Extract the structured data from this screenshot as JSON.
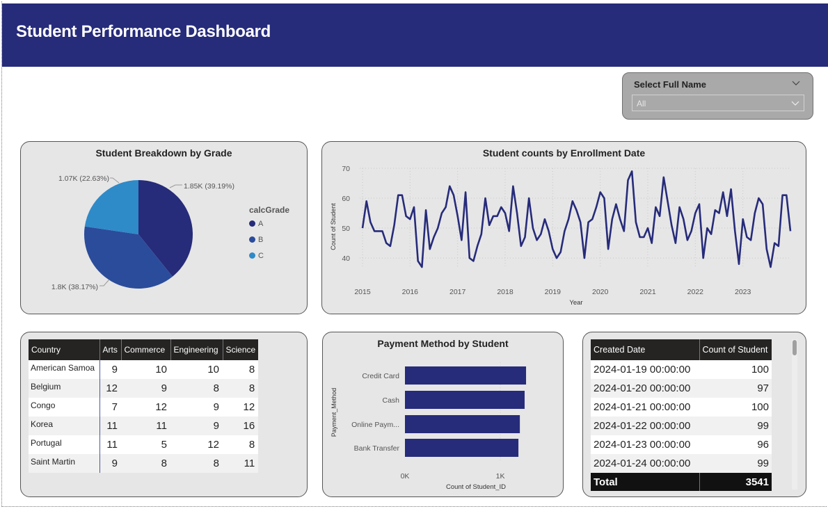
{
  "header": {
    "title": "Student Performance Dashboard"
  },
  "slicer": {
    "title": "Select Full Name",
    "value": "All"
  },
  "pie": {
    "title": "Student Breakdown by Grade",
    "legend_title": "calcGrade",
    "items": [
      {
        "label": "A",
        "data_label": "1.85K (39.19%)",
        "color": "#262b7a"
      },
      {
        "label": "B",
        "data_label": "1.8K (38.17%)",
        "color": "#2b4c9b"
      },
      {
        "label": "C",
        "data_label": "1.07K (22.63%)",
        "color": "#2f8ac8"
      }
    ]
  },
  "line": {
    "title": "Student counts by Enrollment Date"
  },
  "country_table": {
    "headers": [
      "Country",
      "Arts",
      "Commerce",
      "Engineering",
      "Science"
    ],
    "rows": [
      [
        "American Samoa",
        "9",
        "10",
        "10",
        "8"
      ],
      [
        "Belgium",
        "12",
        "9",
        "8",
        "8"
      ],
      [
        "Congo",
        "7",
        "12",
        "9",
        "12"
      ],
      [
        "Korea",
        "11",
        "11",
        "9",
        "16"
      ],
      [
        "Portugal",
        "11",
        "5",
        "12",
        "8"
      ],
      [
        "Saint Martin",
        "9",
        "8",
        "8",
        "11"
      ]
    ]
  },
  "bar": {
    "title": "Payment Method by Student"
  },
  "date_table": {
    "headers": [
      "Created Date",
      "Count of Student"
    ],
    "rows": [
      [
        "2024-01-19 00:00:00",
        "100"
      ],
      [
        "2024-01-20 00:00:00",
        "97"
      ],
      [
        "2024-01-21 00:00:00",
        "100"
      ],
      [
        "2024-01-22 00:00:00",
        "99"
      ],
      [
        "2024-01-23 00:00:00",
        "96"
      ],
      [
        "2024-01-24 00:00:00",
        "99"
      ]
    ],
    "total_label": "Total",
    "total_value": "3541"
  },
  "chart_data": [
    {
      "type": "pie",
      "title": "Student Breakdown by Grade",
      "categories": [
        "A",
        "B",
        "C"
      ],
      "values": [
        1850,
        1800,
        1070
      ],
      "percentages": [
        39.19,
        38.17,
        22.63
      ],
      "data_labels": [
        "1.85K (39.19%)",
        "1.8K (38.17%)",
        "1.07K (22.63%)"
      ],
      "legend_title": "calcGrade",
      "legend_position": "right"
    },
    {
      "type": "line",
      "title": "Student counts by Enrollment Date",
      "xlabel": "Year",
      "ylabel": "Count of Student",
      "xlim": [
        2015,
        2024
      ],
      "ylim": [
        37,
        70
      ],
      "yticks": [
        40,
        50,
        60,
        70
      ],
      "xticks": [
        "2015",
        "2016",
        "2017",
        "2018",
        "2019",
        "2020",
        "2021",
        "2022",
        "2023"
      ],
      "grid": "dotted",
      "color": "#262b7a",
      "x_start": 2015,
      "x_step_months": 1,
      "values": [
        50,
        59,
        52,
        49,
        49,
        49,
        45,
        44,
        51,
        61,
        61,
        54,
        53,
        57,
        39,
        37,
        56,
        43,
        47,
        50,
        55,
        57,
        64,
        61,
        54,
        46,
        62,
        40,
        39,
        44,
        48,
        60,
        51,
        54,
        54,
        57,
        55,
        49,
        64,
        55,
        44,
        47,
        60,
        50,
        46,
        48,
        53,
        49,
        43,
        40,
        42,
        49,
        53,
        59,
        56,
        52,
        40,
        52,
        53,
        57,
        62,
        60,
        43,
        53,
        58,
        53,
        49,
        66,
        69,
        52,
        47,
        47,
        50,
        45,
        57,
        54,
        67,
        59,
        51,
        45,
        57,
        53,
        46,
        49,
        55,
        58,
        40,
        50,
        48,
        56,
        55,
        62,
        54,
        63,
        49,
        38,
        53,
        47,
        46,
        55,
        60,
        58,
        43,
        37,
        45,
        44,
        61,
        61,
        49
      ]
    },
    {
      "type": "bar",
      "orientation": "horizontal",
      "title": "Payment Method by Student",
      "xlabel": "Count of Student_ID",
      "ylabel": "Payment_Method",
      "categories": [
        "Credit Card",
        "Cash",
        "Online Paym...",
        "Bank Transfer"
      ],
      "values": [
        1270,
        1255,
        1205,
        1190
      ],
      "xticks": [
        "0K",
        "1K"
      ],
      "xlim": [
        0,
        1350
      ],
      "color": "#262b7a"
    }
  ]
}
